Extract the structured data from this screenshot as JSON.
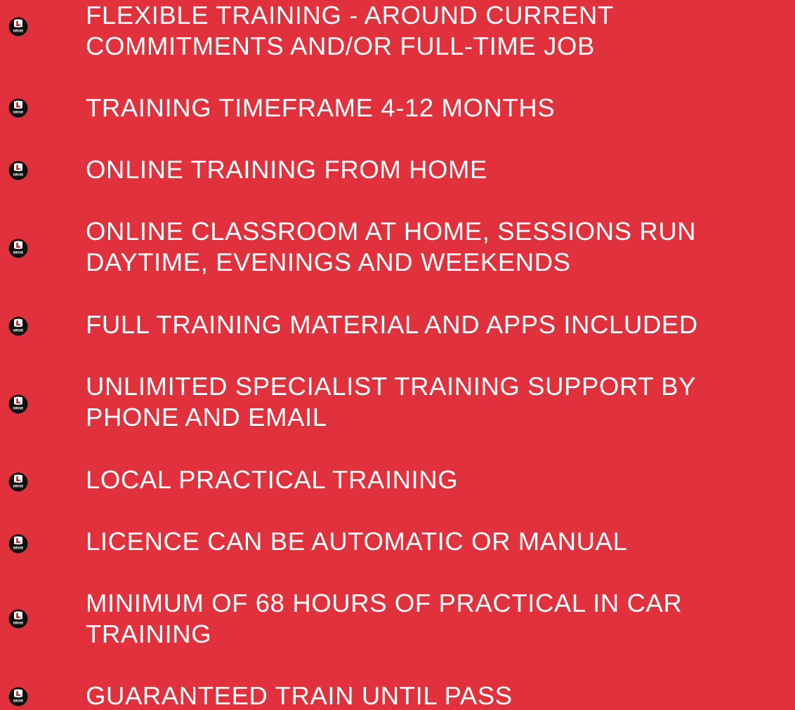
{
  "brand": {
    "badge_icon": "l-drive-logo-icon",
    "badge_letter": "L",
    "badge_subtext": "DRIVE",
    "background_color": "#e1313c",
    "badge_color": "#111111",
    "text_color": "#ffffff"
  },
  "features": [
    {
      "lines": [
        "FLEXIBLE TRAINING  - AROUND CURRENT",
        "COMMITMENTS AND/OR FULL-TIME JOB"
      ]
    },
    {
      "lines": [
        "TRAINING TIMEFRAME 4-12 MONTHS"
      ]
    },
    {
      "lines": [
        "ONLINE TRAINING FROM HOME"
      ]
    },
    {
      "lines": [
        "ONLINE CLASSROOM AT HOME, SESSIONS RUN",
        "DAYTIME, EVENINGS AND WEEKENDS"
      ]
    },
    {
      "lines": [
        "FULL TRAINING MATERIAL AND APPS INCLUDED"
      ]
    },
    {
      "lines": [
        "UNLIMITED SPECIALIST TRAINING SUPPORT BY",
        "PHONE AND EMAIL"
      ]
    },
    {
      "lines": [
        "LOCAL PRACTICAL TRAINING"
      ]
    },
    {
      "lines": [
        "LICENCE CAN BE AUTOMATIC OR MANUAL"
      ]
    },
    {
      "lines": [
        "MINIMUM OF 68 HOURS OF PRACTICAL IN CAR",
        "TRAINING"
      ]
    },
    {
      "lines": [
        "GUARANTEED TRAIN UNTIL PASS"
      ]
    }
  ]
}
